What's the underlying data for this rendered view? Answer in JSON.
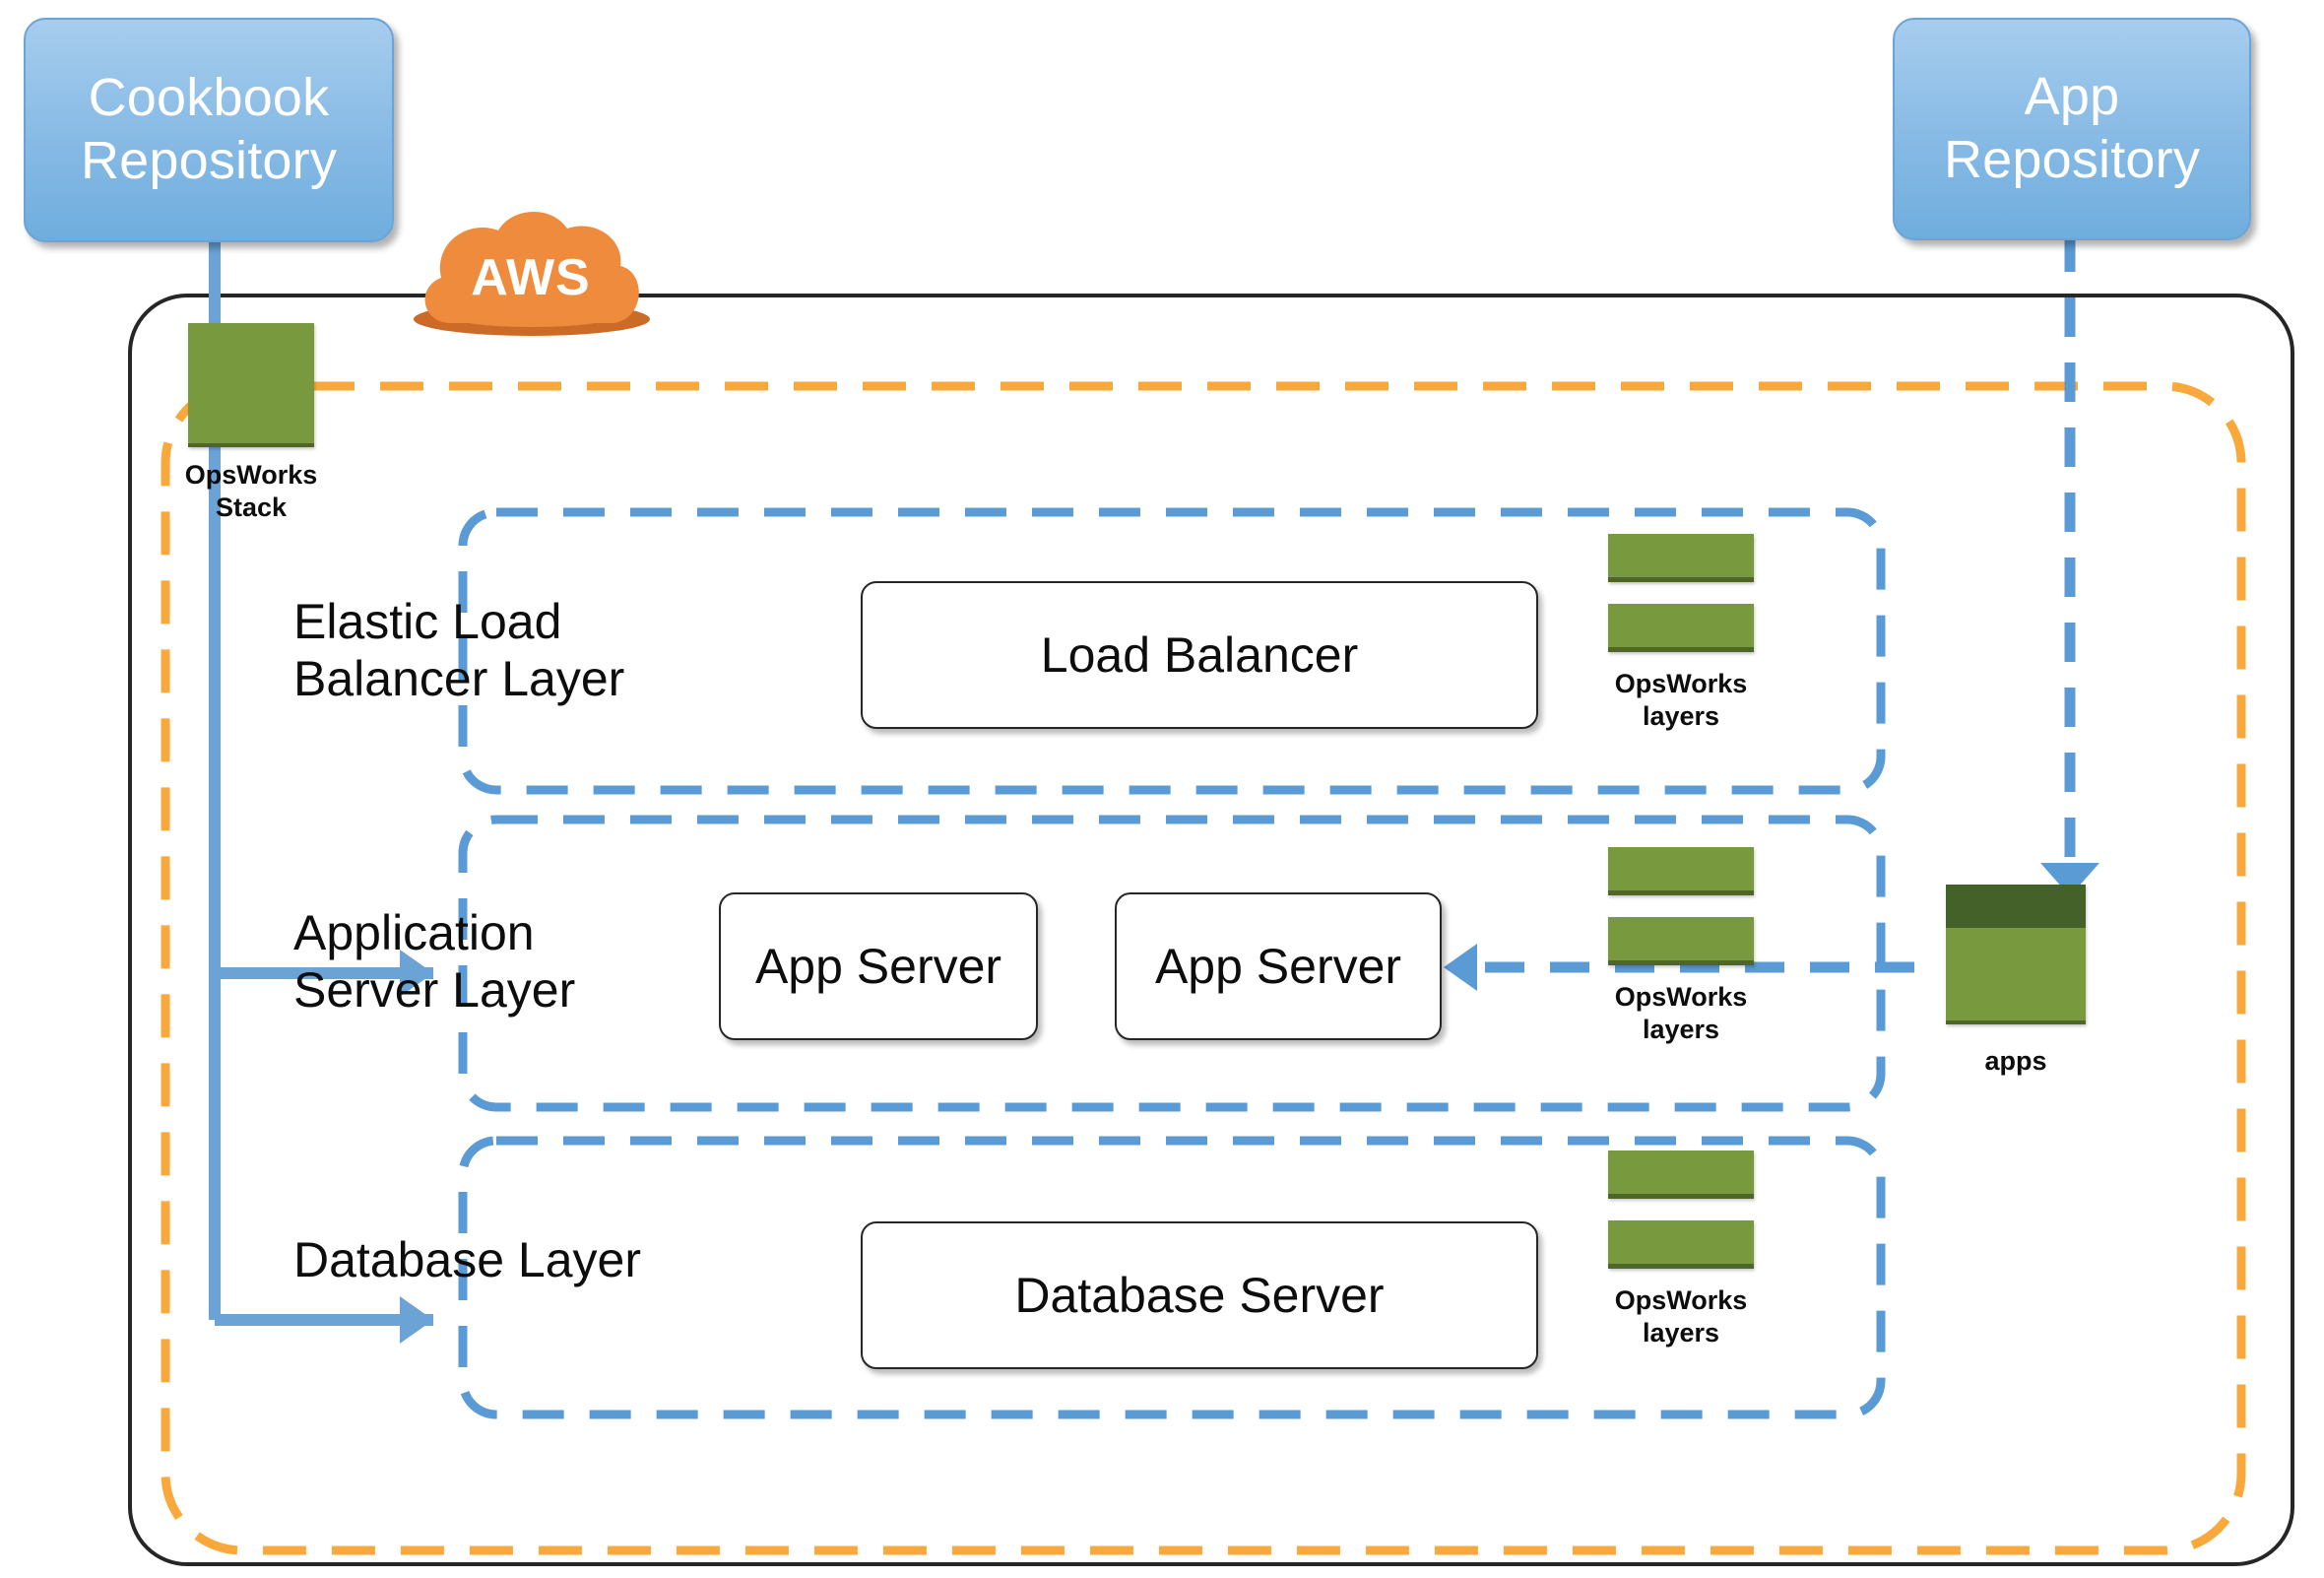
{
  "diagram": {
    "title": "AWS OpsWorks stack architecture",
    "cloud_provider_label": "AWS",
    "colors": {
      "repo_blue": "#8cbde6",
      "dashed_blue": "#5b9bd5",
      "dashed_orange": "#f9a93c",
      "opsworks_green": "#79993f",
      "opsworks_green_dark": "#44612a",
      "boundary_black": "#262626"
    }
  },
  "external": {
    "cookbook_repository": "Cookbook\nRepository",
    "app_repository": "App\nRepository"
  },
  "stack": {
    "caption": "OpsWorks\nStack"
  },
  "layers": [
    {
      "id": "elastic-load-balancer",
      "title": "Elastic Load\nBalancer Layer",
      "nodes": [
        "Load Balancer"
      ],
      "glyph_caption": "OpsWorks\nlayers",
      "glyph_bar_count": 2
    },
    {
      "id": "application-server",
      "title": "Application\nServer Layer",
      "nodes": [
        "App Server",
        "App Server"
      ],
      "glyph_caption": "OpsWorks\nlayers",
      "glyph_bar_count": 2
    },
    {
      "id": "database",
      "title": "Database Layer",
      "nodes": [
        "Database Server"
      ],
      "glyph_caption": "OpsWorks\nlayers",
      "glyph_bar_count": 2
    }
  ],
  "nodes": {
    "load_balancer": "Load Balancer",
    "app_server_1": "App Server",
    "app_server_2": "App Server",
    "database_server": "Database Server"
  },
  "apps": {
    "caption": "apps"
  },
  "layer_glyph_captions": {
    "elb": "OpsWorks\nlayers",
    "app": "OpsWorks\nlayers",
    "db": "OpsWorks\nlayers"
  }
}
